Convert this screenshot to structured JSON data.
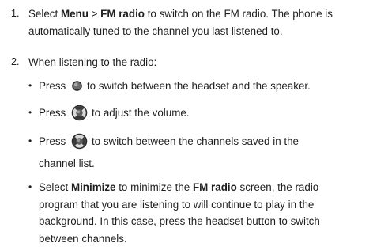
{
  "steps": [
    {
      "number": "1.",
      "lines": [
        {
          "pre": "Select ",
          "menu": "Menu",
          "sep": " > ",
          "fm": "FM radio",
          "post": " to switch on the FM radio. The phone is"
        },
        {
          "text": "automatically tuned to the channel you last listened to."
        }
      ]
    },
    {
      "number": "2.",
      "intro": "When listening to the radio:",
      "bullets": [
        {
          "marker": "•",
          "pre": "Press ",
          "icon": "center-key-icon",
          "post": "to switch between the headset and the speaker."
        },
        {
          "marker": "•",
          "pre": "Press ",
          "icon": "nav-key-updown-icon",
          "post": "to adjust the volume."
        },
        {
          "marker": "•",
          "pre": "Press ",
          "icon": "nav-key-leftright-icon",
          "post": "to switch between the channels saved in the",
          "cont": "channel list."
        },
        {
          "marker": "•",
          "line1_pre": "Select ",
          "line1_bold": "Minimize",
          "line1_mid": " to minimize the ",
          "line1_bold2": "FM radio",
          "line1_post": " screen, the radio",
          "line2": "program that you are listening to will continue to play in the",
          "line3": "background. In this case, press the headset button to switch",
          "line4": "between channels."
        }
      ]
    }
  ],
  "colors": {
    "text": "#1f1f1f",
    "icon_dark": "#2a2a2a",
    "icon_mid": "#8c8c8c",
    "icon_light": "#d9d9d9"
  }
}
